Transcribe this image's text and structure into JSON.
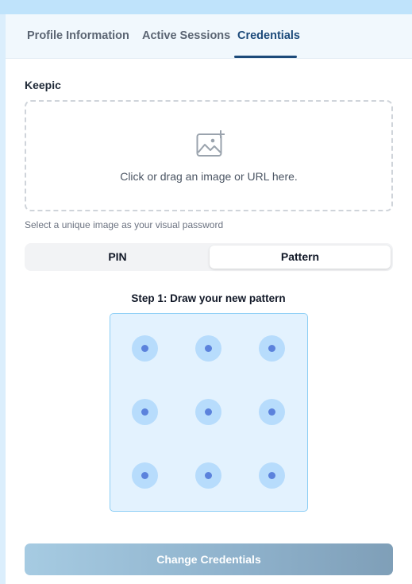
{
  "tabs": {
    "profile": "Profile Information",
    "sessions": "Active Sessions",
    "credentials": "Credentials"
  },
  "keepic": {
    "label": "Keepic",
    "dropzone_text": "Click or drag an image or URL here.",
    "helper_text": "Select a unique image as your visual password"
  },
  "segmented": {
    "pin": "PIN",
    "pattern": "Pattern",
    "selected": "Pattern"
  },
  "pattern": {
    "step_label": "Step 1: Draw your new pattern",
    "grid": "3x3"
  },
  "actions": {
    "submit": "Change Credentials"
  },
  "colors": {
    "accent": "#1c4a7a",
    "pattern_bg": "#e3f2fe",
    "dot_outer": "#b7dcfc",
    "dot_inner": "#5b82dc"
  }
}
